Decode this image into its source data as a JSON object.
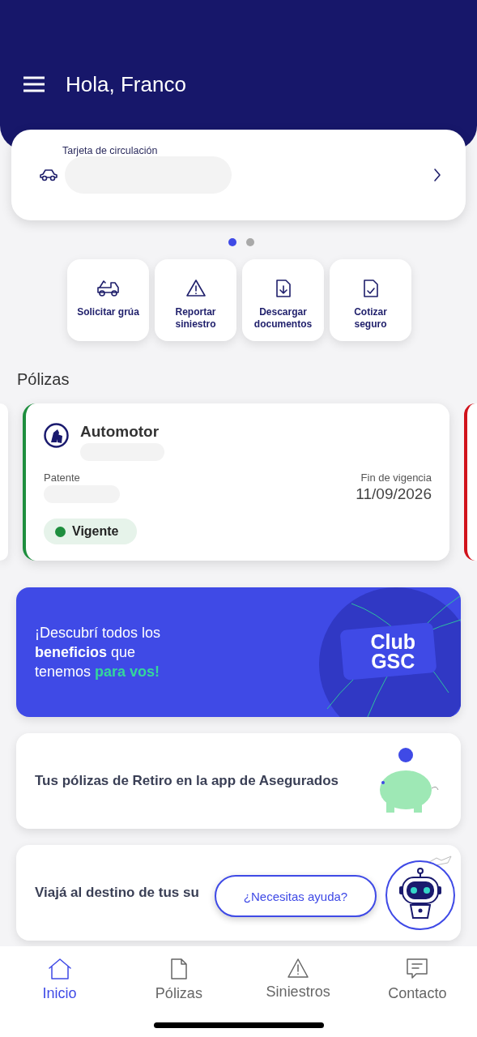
{
  "header": {
    "title": "Hola, Franco"
  },
  "vehicle_card": {
    "label": "Tarjeta de circulación"
  },
  "carousel_dots": [
    {
      "selected": true
    },
    {
      "selected": false
    }
  ],
  "quick_actions": [
    {
      "kind": "tow",
      "label": "Solicitar grúa"
    },
    {
      "kind": "warning",
      "label": "Reportar siniestro"
    },
    {
      "kind": "download",
      "label": "Descargar documentos"
    },
    {
      "kind": "quote",
      "label": "Cotizar seguro"
    }
  ],
  "policies_heading": "Pólizas",
  "policy": {
    "type": "Automotor",
    "plate_label": "Patente",
    "end_label": "Fin de vigencia",
    "end_date": "11/09/2026",
    "status": "Vigente",
    "color": "#1e8e3e"
  },
  "next_policy": {
    "color": "#d0121b"
  },
  "club_banner": {
    "parts": [
      {
        "text": "¡Descubrí todos los ",
        "kind": "plain"
      },
      {
        "text": "beneficios",
        "kind": "bold"
      },
      {
        "text": " que tenemos ",
        "kind": "plain"
      },
      {
        "text": "para vos!",
        "kind": "accent"
      }
    ],
    "logo_top": "Club",
    "logo_bottom": "GSC"
  },
  "promos": [
    {
      "kind": "piggy",
      "text": "Tus pólizas de Retiro en la app de Asegurados"
    },
    {
      "kind": "travel",
      "text": "Viajá al destino de tus su"
    }
  ],
  "help_bubble": "¿Necesitas ayuda?",
  "tabs": [
    {
      "kind": "home",
      "label": "Inicio",
      "selected": true
    },
    {
      "kind": "doc",
      "label": "Pólizas",
      "selected": false
    },
    {
      "kind": "warning",
      "label": "Siniestros",
      "selected": false
    },
    {
      "kind": "chat",
      "label": "Contacto",
      "selected": false
    }
  ]
}
